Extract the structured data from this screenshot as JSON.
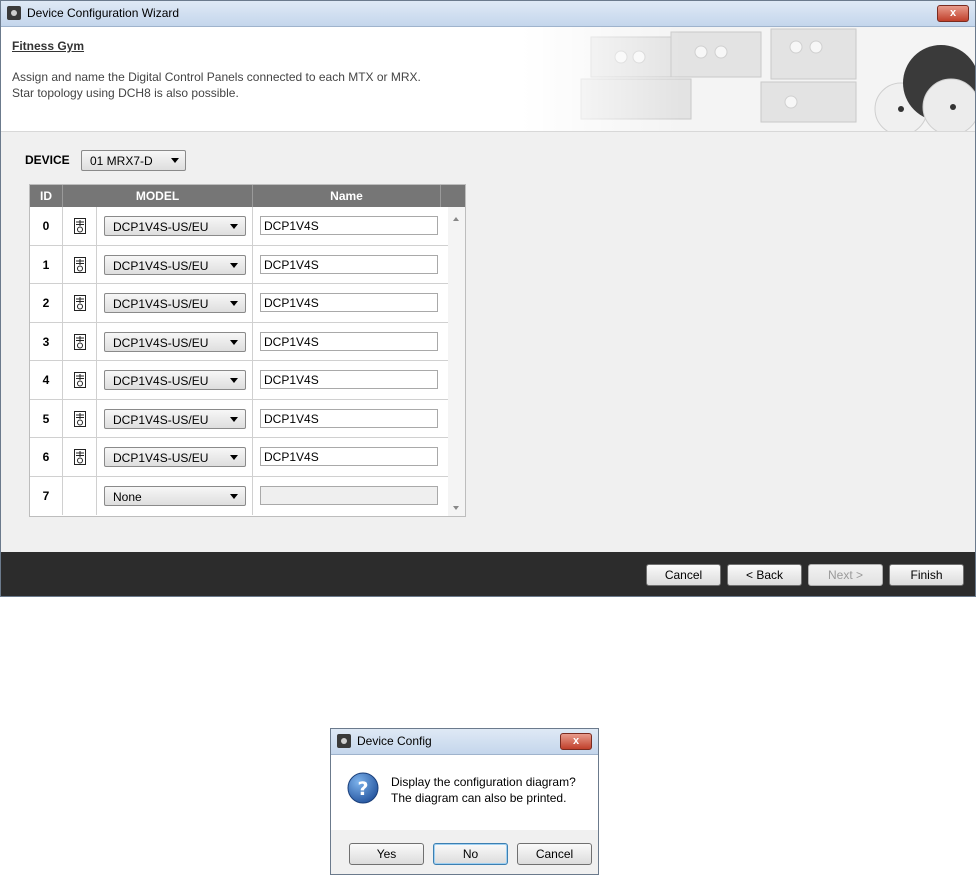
{
  "wizard": {
    "title": "Device Configuration Wizard",
    "close_label": "x",
    "site_name": "Fitness Gym",
    "description_line1": "Assign and name the Digital Control Panels connected to each MTX or MRX.",
    "description_line2": "Star topology using DCH8 is also possible.",
    "device_label": "DEVICE",
    "device_value": "01 MRX7-D",
    "columns": {
      "id": "ID",
      "model": "MODEL",
      "name": "Name"
    },
    "rows": [
      {
        "id": "0",
        "model": "DCP1V4S-US/EU",
        "name": "DCP1V4S"
      },
      {
        "id": "1",
        "model": "DCP1V4S-US/EU",
        "name": "DCP1V4S"
      },
      {
        "id": "2",
        "model": "DCP1V4S-US/EU",
        "name": "DCP1V4S"
      },
      {
        "id": "3",
        "model": "DCP1V4S-US/EU",
        "name": "DCP1V4S"
      },
      {
        "id": "4",
        "model": "DCP1V4S-US/EU",
        "name": "DCP1V4S"
      },
      {
        "id": "5",
        "model": "DCP1V4S-US/EU",
        "name": "DCP1V4S"
      },
      {
        "id": "6",
        "model": "DCP1V4S-US/EU",
        "name": "DCP1V4S"
      },
      {
        "id": "7",
        "model": "None",
        "name": ""
      }
    ],
    "buttons": {
      "cancel": "Cancel",
      "back": "< Back",
      "next": "Next >",
      "finish": "Finish"
    }
  },
  "dialog": {
    "title": "Device Config",
    "close_label": "x",
    "message_line1": "Display the configuration diagram?",
    "message_line2": "The diagram can also be printed.",
    "buttons": {
      "yes": "Yes",
      "no": "No",
      "cancel": "Cancel"
    }
  },
  "icons": {
    "app": "app-icon",
    "panel": "control-panel-icon",
    "question": "question-icon"
  },
  "colors": {
    "footer_bar": "#2c2c2c",
    "table_header": "#767676",
    "close_button": "#c0402b"
  }
}
